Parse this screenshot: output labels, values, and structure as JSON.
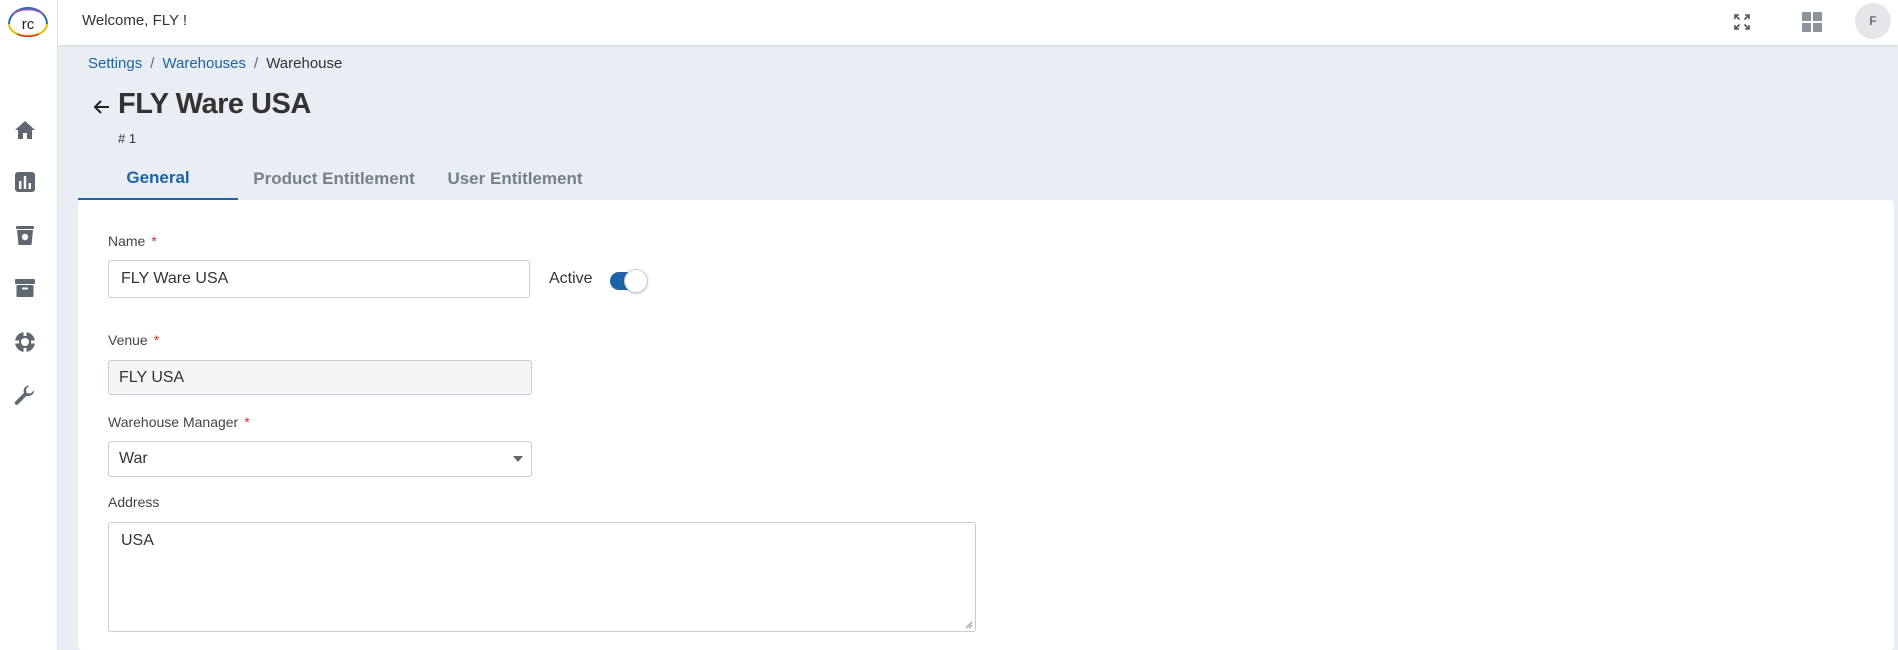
{
  "header": {
    "welcome": "Welcome, FLY !",
    "avatar_initial": "F"
  },
  "sidebar": {
    "logo_text": "rc",
    "items": [
      {
        "name": "home-icon"
      },
      {
        "name": "bar-chart-icon"
      },
      {
        "name": "bin-icon"
      },
      {
        "name": "archive-icon"
      },
      {
        "name": "support-icon"
      },
      {
        "name": "wrench-icon"
      }
    ]
  },
  "breadcrumb": {
    "item1": "Settings",
    "item2": "Warehouses",
    "item3": "Warehouse",
    "separator": "/"
  },
  "page": {
    "title": "FLY Ware USA",
    "subtitle": "# 1"
  },
  "tabs": {
    "general": "General",
    "product": "Product Entitlement",
    "user": "User Entitlement"
  },
  "form": {
    "name_label": "Name",
    "name_value": "FLY Ware USA",
    "required_mark": "*",
    "active_label": "Active",
    "active_on": true,
    "venue_label": "Venue",
    "venue_value": "FLY USA",
    "manager_label": "Warehouse Manager",
    "manager_value": "War",
    "address_label": "Address",
    "address_value": "USA"
  },
  "colors": {
    "accent": "#1d63a6",
    "required": "#d32f2f",
    "page_bg": "#e8eef4"
  }
}
